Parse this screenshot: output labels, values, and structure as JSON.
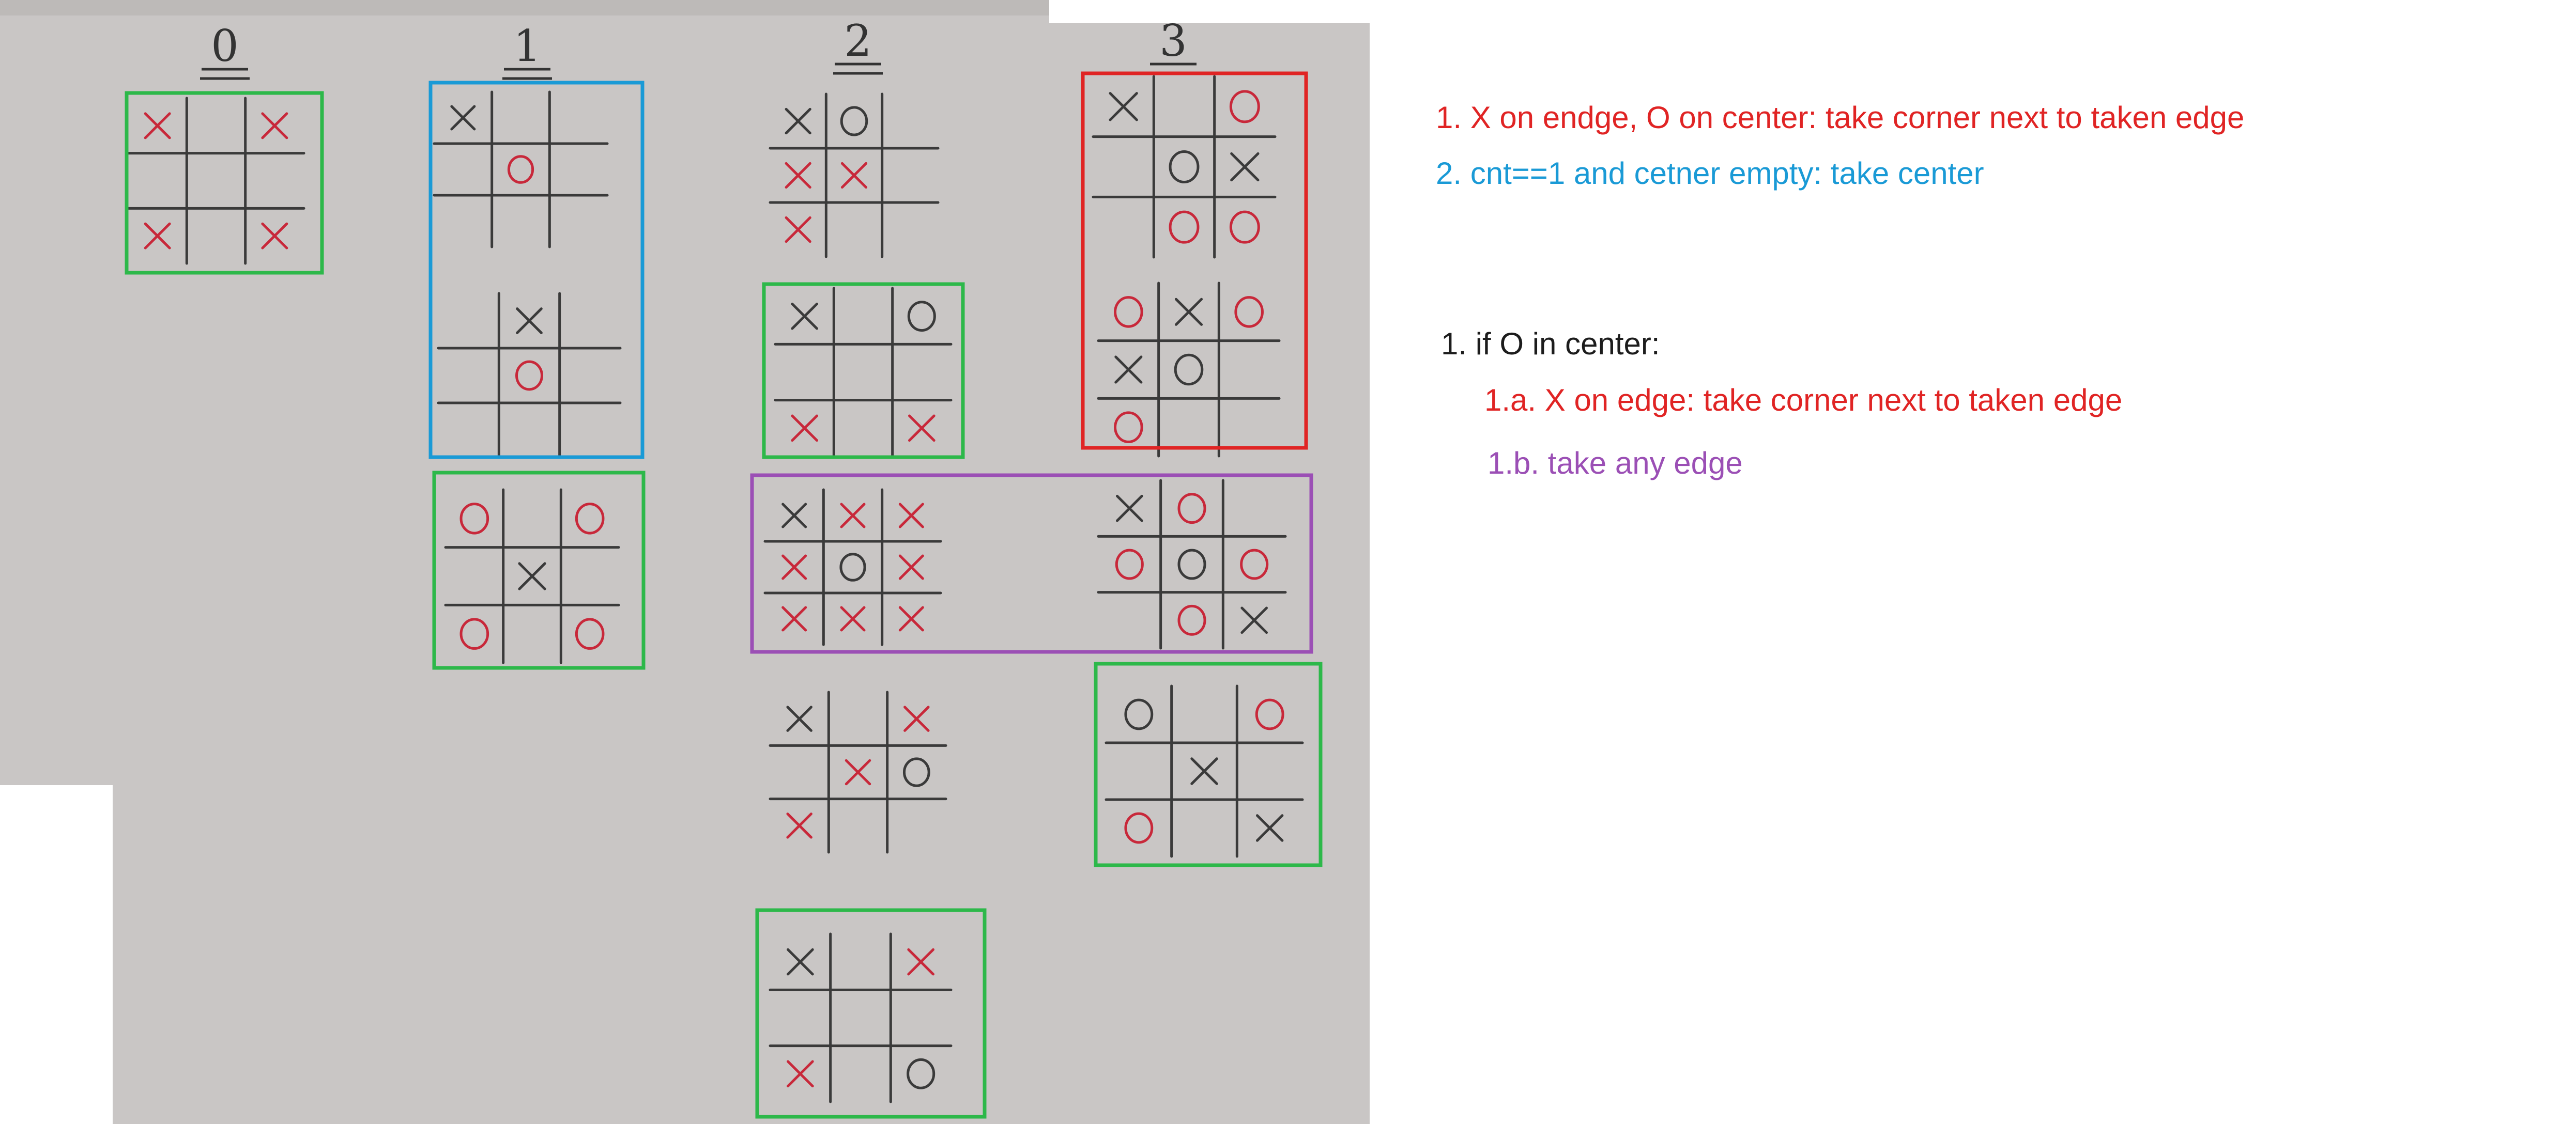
{
  "columns": [
    "0",
    "1",
    "2",
    "3"
  ],
  "colors": {
    "red": "#e02424",
    "blue": "#1a9ad6",
    "green": "#2db84a",
    "purple": "#9b4fb5",
    "black": "#1c1c1c",
    "ink_black": "#3a3a3a",
    "ink_red": "#c8283a",
    "paper": "#c9c6c5",
    "paper_dark": "#bdbab8",
    "wood": "#8a6a3c"
  },
  "boards": [
    {
      "id": "c0-a",
      "col": 0,
      "cells": [
        "rX",
        "",
        "rX",
        "",
        "",
        "",
        "rX",
        "",
        "rX"
      ]
    },
    {
      "id": "c1-a",
      "col": 1,
      "cells": [
        "bX",
        "",
        "",
        "",
        "rO",
        "",
        "",
        "",
        ""
      ]
    },
    {
      "id": "c1-b",
      "col": 1,
      "cells": [
        "",
        "bX",
        "",
        "",
        "rO",
        "",
        "",
        "",
        ""
      ]
    },
    {
      "id": "c1-c",
      "col": 1,
      "cells": [
        "rO",
        "",
        "rO",
        "",
        "bX",
        "",
        "rO",
        "",
        "rO"
      ]
    },
    {
      "id": "c2-a",
      "col": 2,
      "cells": [
        "bX",
        "bO",
        "",
        "rX",
        "rX",
        "",
        "rX",
        "",
        ""
      ]
    },
    {
      "id": "c2-b",
      "col": 2,
      "cells": [
        "bX",
        "",
        "bO",
        "",
        "",
        "",
        "rX",
        "",
        "rX"
      ]
    },
    {
      "id": "c2-c",
      "col": 2,
      "cells": [
        "bX",
        "rX",
        "rX",
        "rX",
        "bO",
        "rX",
        "rX",
        "rX",
        "rX"
      ]
    },
    {
      "id": "c2-d",
      "col": 2,
      "cells": [
        "bX",
        "",
        "rX",
        "",
        "rX",
        "bO",
        "rX",
        "",
        ""
      ]
    },
    {
      "id": "c2-e",
      "col": 2,
      "cells": [
        "bX",
        "",
        "rX",
        "",
        "",
        "",
        "rX",
        "",
        "bO"
      ]
    },
    {
      "id": "c3-a",
      "col": 3,
      "cells": [
        "bX",
        "",
        "rO",
        "",
        "bO",
        "bX",
        "",
        "rO",
        "rO"
      ]
    },
    {
      "id": "c3-b",
      "col": 3,
      "cells": [
        "rO",
        "bX",
        "rO",
        "bX",
        "bO",
        "",
        "rO",
        "",
        ""
      ]
    },
    {
      "id": "c3-c",
      "col": 3,
      "cells": [
        "bX",
        "rO",
        "",
        "rO",
        "bO",
        "rO",
        "",
        "rO",
        "bX"
      ]
    },
    {
      "id": "c3-d",
      "col": 3,
      "cells": [
        "bO",
        "",
        "rO",
        "",
        "bX",
        "",
        "rO",
        "",
        "bX"
      ]
    }
  ],
  "highlights": [
    {
      "id": "hl-c0-a",
      "color": "green"
    },
    {
      "id": "hl-c1-ab",
      "color": "blue"
    },
    {
      "id": "hl-c1-c",
      "color": "green"
    },
    {
      "id": "hl-c2-b",
      "color": "green"
    },
    {
      "id": "hl-c3-ab",
      "color": "red"
    },
    {
      "id": "hl-row-purple",
      "color": "purple"
    },
    {
      "id": "hl-c3-d",
      "color": "green"
    },
    {
      "id": "hl-c2-e",
      "color": "green"
    }
  ],
  "notes": {
    "rule1": "1.  X on endge, O on center: take corner next to taken edge",
    "rule2": "2.  cnt==1 and cetner empty: take center",
    "if_center": "1. if O in center:",
    "rule1a": "1.a.   X on edge: take corner next to taken edge",
    "rule1b": "1.b.   take any edge"
  }
}
